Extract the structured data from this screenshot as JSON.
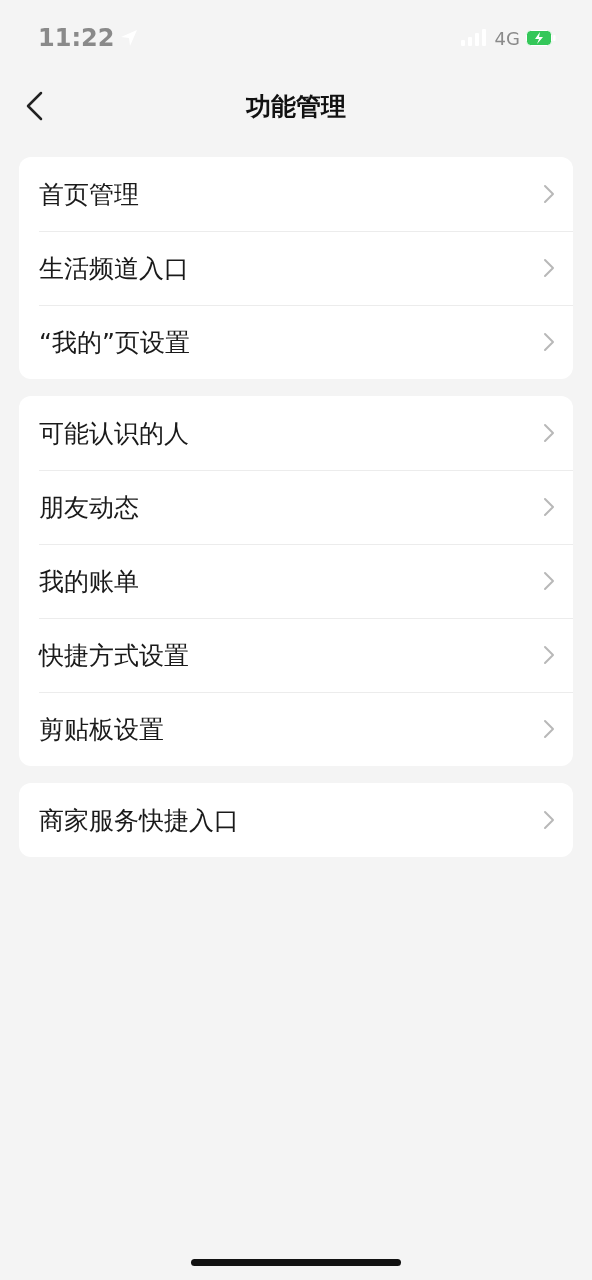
{
  "status_bar": {
    "time": "11:22",
    "network": "4G"
  },
  "nav": {
    "title": "功能管理"
  },
  "groups": [
    {
      "items": [
        {
          "label": "首页管理"
        },
        {
          "label": "生活频道入口"
        },
        {
          "label": "“我的”页设置"
        }
      ]
    },
    {
      "items": [
        {
          "label": "可能认识的人"
        },
        {
          "label": "朋友动态"
        },
        {
          "label": "我的账单"
        },
        {
          "label": "快捷方式设置"
        },
        {
          "label": "剪贴板设置"
        }
      ]
    },
    {
      "items": [
        {
          "label": "商家服务快捷入口"
        }
      ]
    }
  ]
}
